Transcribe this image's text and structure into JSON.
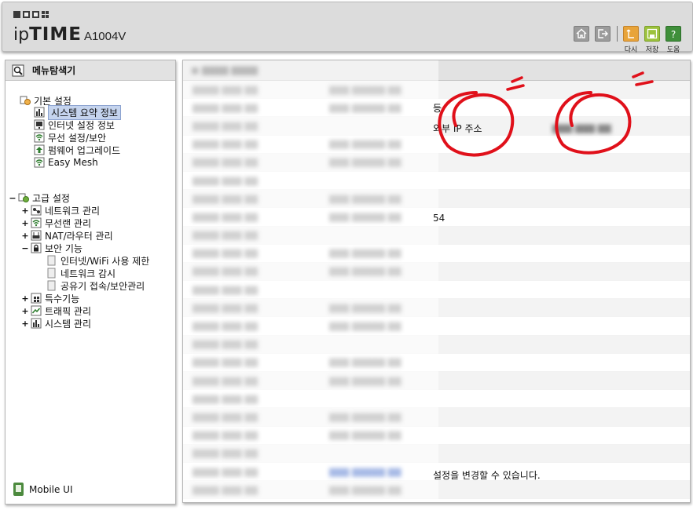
{
  "header": {
    "brand_prefix": "ip",
    "brand_name": "TIME",
    "model": "A1004V",
    "toolbar": {
      "home_icon": "home-icon",
      "logout_icon": "logout-icon",
      "reload_label": "다시",
      "save_label": "저장",
      "help_label": "도움"
    }
  },
  "sidebar": {
    "title": "메뉴탐색기",
    "basic": {
      "label": "기본 설정",
      "items": [
        {
          "label": "시스템 요약 정보",
          "selected": true
        },
        {
          "label": "인터넷 설정 정보"
        },
        {
          "label": "무선 설정/보안"
        },
        {
          "label": "펌웨어 업그레이드"
        },
        {
          "label": "Easy Mesh"
        }
      ]
    },
    "advanced": {
      "label": "고급 설정",
      "items": [
        {
          "label": "네트워크 관리"
        },
        {
          "label": "무선랜 관리"
        },
        {
          "label": "NAT/라우터 관리"
        },
        {
          "label": "보안 기능"
        },
        {
          "label": "특수기능"
        },
        {
          "label": "트래픽 관리"
        },
        {
          "label": "시스템 관리"
        }
      ],
      "security_children": [
        {
          "label": "인터넷/WiFi 사용 제한"
        },
        {
          "label": "네트워크 감시"
        },
        {
          "label": "공유기 접속/보안관리"
        }
      ]
    },
    "mobile_label": "Mobile UI"
  },
  "main": {
    "external_ip_label": "외부 IP 주소",
    "partial_value": "54",
    "note_text": "설정을 변경할 수 있습니다.",
    "row_count": 23
  },
  "colors": {
    "annotation_red": "#e0101a",
    "selection_bg": "#c5d4ee",
    "header_bg": "#dcdcdc"
  }
}
